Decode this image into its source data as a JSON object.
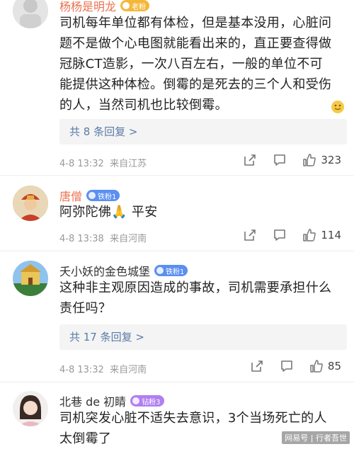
{
  "comments": [
    {
      "username": "杨杨是明龙",
      "badge": "老粉",
      "text_lines": [
        "司机每年单位都有体检，但是基本没用，心脏问",
        "题不是做个心电图就能看出来的，直正要查得做",
        "冠脉CT造影，一次八百左右，一般的单位不可",
        "能提供这种体检。倒霉的是死去的三个人和受伤",
        "的人，当然司机也比较倒霉。"
      ],
      "reply": "共 8 条回复 >",
      "time": "4-8 13:32",
      "location": "来自江苏",
      "likes": "323"
    },
    {
      "username": "唐僧",
      "badge": "铁粉1",
      "text_lines": [
        "阿弥陀佛🙏 平安"
      ],
      "time": "4-8 13:38",
      "location": "来自河南",
      "likes": "114"
    },
    {
      "username": "夭小妖的金色城堡",
      "badge": "铁粉1",
      "text_lines": [
        "这种非主观原因造成的事故，司机需要承担什么",
        "责任吗？"
      ],
      "reply": "共 17 条回复 >",
      "time": "4-8 13:32",
      "location": "来自河南",
      "likes": "85"
    },
    {
      "username": "北巷 de 初睛",
      "badge": "钻粉3",
      "text_lines": [
        "司机突发心脏不适失去意识，3个当场死亡的人",
        "太倒霉了"
      ]
    }
  ],
  "watermark": "网易号 | 行者吾世",
  "colors": {
    "accent": "#eb7350",
    "link": "#5a7ba8",
    "meta": "#999999"
  }
}
